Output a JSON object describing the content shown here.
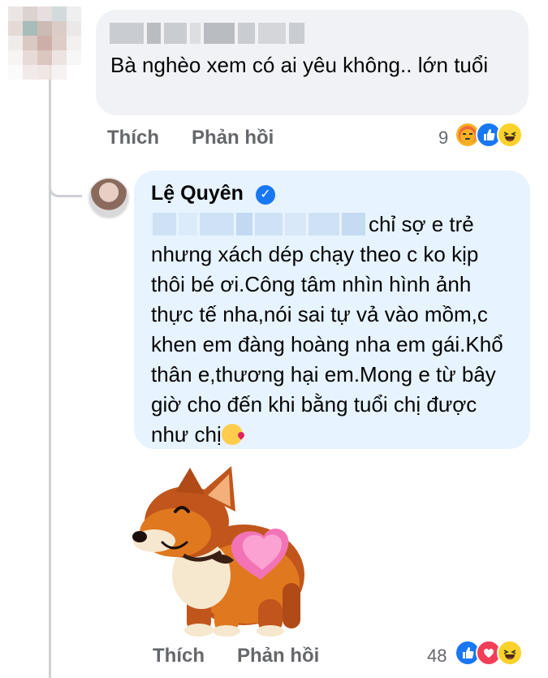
{
  "comment": {
    "author_censored": true,
    "text": "Bà nghèo xem có ai yêu không.. lớn tuổi",
    "actions": {
      "like": "Thích",
      "reply": "Phản hồi"
    },
    "reaction_count": "9",
    "reactions": [
      "angry-icon",
      "like-icon",
      "haha-icon"
    ]
  },
  "reply": {
    "author": "Lệ Quyên",
    "verified": true,
    "text": "chỉ sợ e trẻ nhưng xách dép chạy theo c ko kịp thôi bé ơi.Công tâm nhìn hình ảnh thực tế nha,nói sai tự vả vào mồm,c khen em đàng hoàng nha em gái.Khổ thân e,thương hại em.Mong e từ bây giờ cho đến khi bằng tuổi chị được như chị",
    "sticker": "corgi-heart-sticker",
    "actions": {
      "like": "Thích",
      "reply": "Phản hồi"
    },
    "reaction_count": "48",
    "reactions": [
      "like-icon",
      "love-icon",
      "haha-icon"
    ]
  },
  "colors": {
    "bubble_gray": "#f0f2f5",
    "bubble_blue": "#e7f3ff",
    "meta_gray": "#65676b",
    "fb_blue": "#1877f2"
  }
}
